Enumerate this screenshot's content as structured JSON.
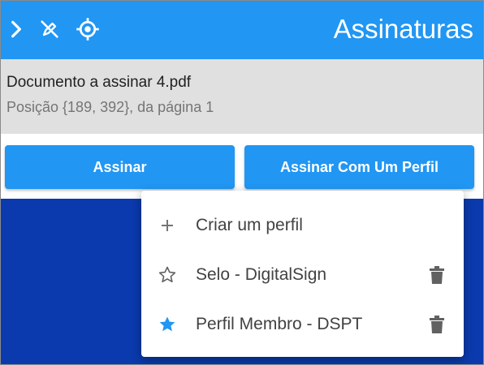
{
  "header": {
    "title": "Assinaturas",
    "icons": [
      "chevron-right-icon",
      "pen-off-icon",
      "crosshair-icon"
    ],
    "background": "#2196f3"
  },
  "document": {
    "name": "Documento a assinar 4.pdf",
    "position_text": "Posição {189, 392}, da página 1"
  },
  "actions": {
    "sign_label": "Assinar",
    "sign_profile_label": "Assinar Com Um Perfil"
  },
  "menu": {
    "items": [
      {
        "label": "Criar um perfil",
        "icon": "plus-icon"
      },
      {
        "label": "Selo - DigitalSign",
        "icon": "star-outline-icon",
        "deletable": true
      },
      {
        "label": "Perfil Membro - DSPT",
        "icon": "star-filled-icon",
        "deletable": true
      }
    ]
  },
  "colors": {
    "primary": "#2196f3",
    "info_bg": "#e0e0e0",
    "backdrop": "#0a3aad",
    "star_active": "#2196f3"
  }
}
